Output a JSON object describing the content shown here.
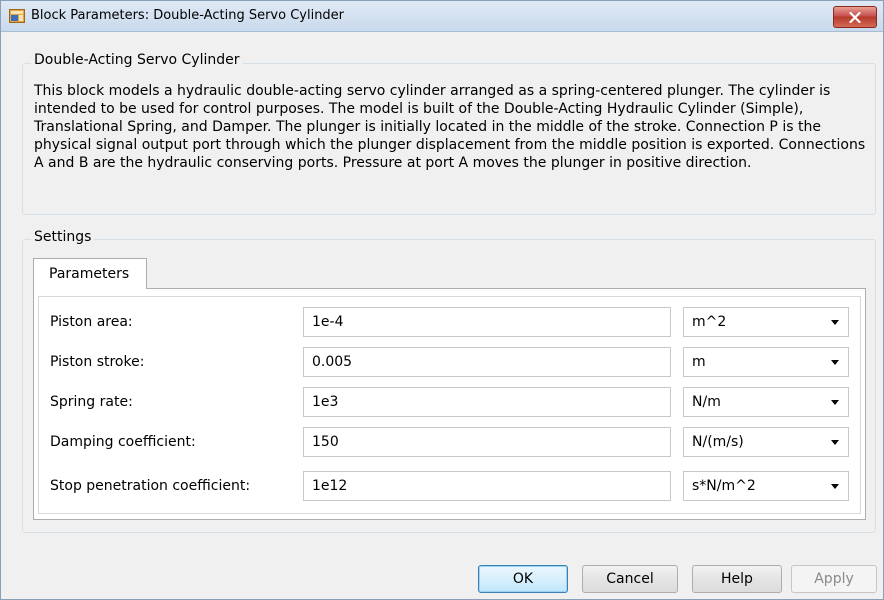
{
  "window": {
    "title": "Block Parameters: Double-Acting Servo Cylinder"
  },
  "block_group": {
    "label": "Double-Acting Servo Cylinder",
    "description": "This block models a hydraulic double-acting servo cylinder arranged as a spring-centered plunger. The cylinder is intended to be used for control purposes. The model is built of the Double-Acting Hydraulic Cylinder (Simple), Translational Spring, and Damper. The plunger is initially located in the middle of the stroke. Connection P is the physical signal output port through which the plunger displacement from the middle position is exported. Connections A and B are the hydraulic conserving ports. Pressure at port A moves the plunger in positive direction."
  },
  "settings": {
    "label": "Settings",
    "tab_label": "Parameters",
    "parameters": [
      {
        "label": "Piston area:",
        "value": "1e-4",
        "unit": "m^2"
      },
      {
        "label": "Piston stroke:",
        "value": "0.005",
        "unit": "m"
      },
      {
        "label": "Spring rate:",
        "value": "1e3",
        "unit": "N/m"
      },
      {
        "label": "Damping coefficient:",
        "value": "150",
        "unit": "N/(m/s)"
      },
      {
        "label": "Stop penetration coefficient:",
        "value": "1e12",
        "unit": "s*N/m^2"
      }
    ]
  },
  "buttons": {
    "ok": "OK",
    "cancel": "Cancel",
    "help": "Help",
    "apply": "Apply"
  },
  "colors": {
    "close_button": "#c75050",
    "default_button_border": "#3c7fb1",
    "disabled_text": "#8a8a8a"
  }
}
